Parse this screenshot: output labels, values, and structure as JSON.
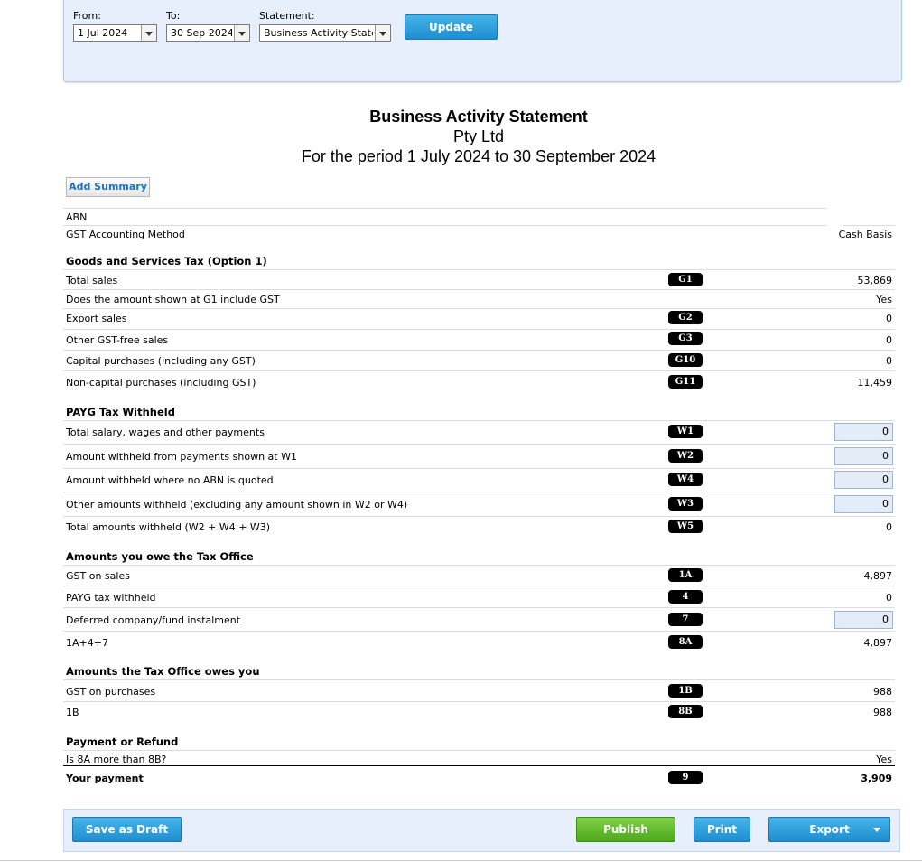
{
  "filters": {
    "from_label": "From:",
    "from_value": "1 Jul 2024",
    "to_label": "To:",
    "to_value": "30 Sep 2024",
    "statement_label": "Statement:",
    "statement_value": "Business Activity Statement",
    "update_label": "Update"
  },
  "report": {
    "title": "Business Activity Statement",
    "company": "Pty Ltd",
    "period": "For the period 1 July 2024 to 30 September 2024",
    "add_summary_label": "Add Summary"
  },
  "general": {
    "abn_label": "ABN",
    "gst_method_label": "GST Accounting Method",
    "gst_method_value": "Cash Basis"
  },
  "gst": {
    "title": "Goods and Services Tax (Option 1)",
    "rows": [
      {
        "label": "Total sales",
        "code": "G1",
        "value": "53,869"
      },
      {
        "label": "Does the amount shown at G1 include GST",
        "code": "",
        "value": "Yes"
      },
      {
        "label": "Export sales",
        "code": "G2",
        "value": "0"
      },
      {
        "label": "Other GST-free sales",
        "code": "G3",
        "value": "0"
      },
      {
        "label": "Capital purchases (including any GST)",
        "code": "G10",
        "value": "0"
      },
      {
        "label": "Non-capital purchases (including GST)",
        "code": "G11",
        "value": "11,459"
      }
    ]
  },
  "payg": {
    "title": "PAYG Tax Withheld",
    "rows": [
      {
        "label": "Total salary, wages and other payments",
        "code": "W1",
        "value": "0"
      },
      {
        "label": "Amount withheld from payments shown at W1",
        "code": "W2",
        "value": "0"
      },
      {
        "label": "Amount withheld where no ABN is quoted",
        "code": "W4",
        "value": "0"
      },
      {
        "label": "Other amounts withheld (excluding any amount shown in W2 or W4)",
        "code": "W3",
        "value": "0"
      },
      {
        "label": "Total amounts withheld (W2 + W4 + W3)",
        "code": "W5",
        "value": "0"
      }
    ]
  },
  "owe": {
    "title": "Amounts you owe the Tax Office",
    "rows": [
      {
        "label": "GST on sales",
        "code": "1A",
        "value": "4,897"
      },
      {
        "label": "PAYG tax withheld",
        "code": "4",
        "value": "0"
      },
      {
        "label": "Deferred company/fund instalment",
        "code": "7",
        "value": "0"
      },
      {
        "label": "1A+4+7",
        "code": "8A",
        "value": "4,897"
      }
    ]
  },
  "owes_you": {
    "title": "Amounts the Tax Office owes you",
    "rows": [
      {
        "label": "GST on purchases",
        "code": "1B",
        "value": "988"
      },
      {
        "label": "1B",
        "code": "8B",
        "value": "988"
      }
    ]
  },
  "payment": {
    "title": "Payment or Refund",
    "rows": [
      {
        "label": "Is 8A more than 8B?",
        "code": "",
        "value": "Yes"
      },
      {
        "label": "Your payment",
        "code": "9",
        "value": "3,909"
      }
    ]
  },
  "footer": {
    "save_draft_label": "Save as Draft",
    "publish_label": "Publish",
    "print_label": "Print",
    "export_label": "Export"
  },
  "colors": {
    "panel_bg": "#e6effb",
    "button_blue": "#2a9ad9",
    "button_green": "#5cb82a",
    "input_bg": "#e3ecf7",
    "badge_bg": "#000000"
  }
}
